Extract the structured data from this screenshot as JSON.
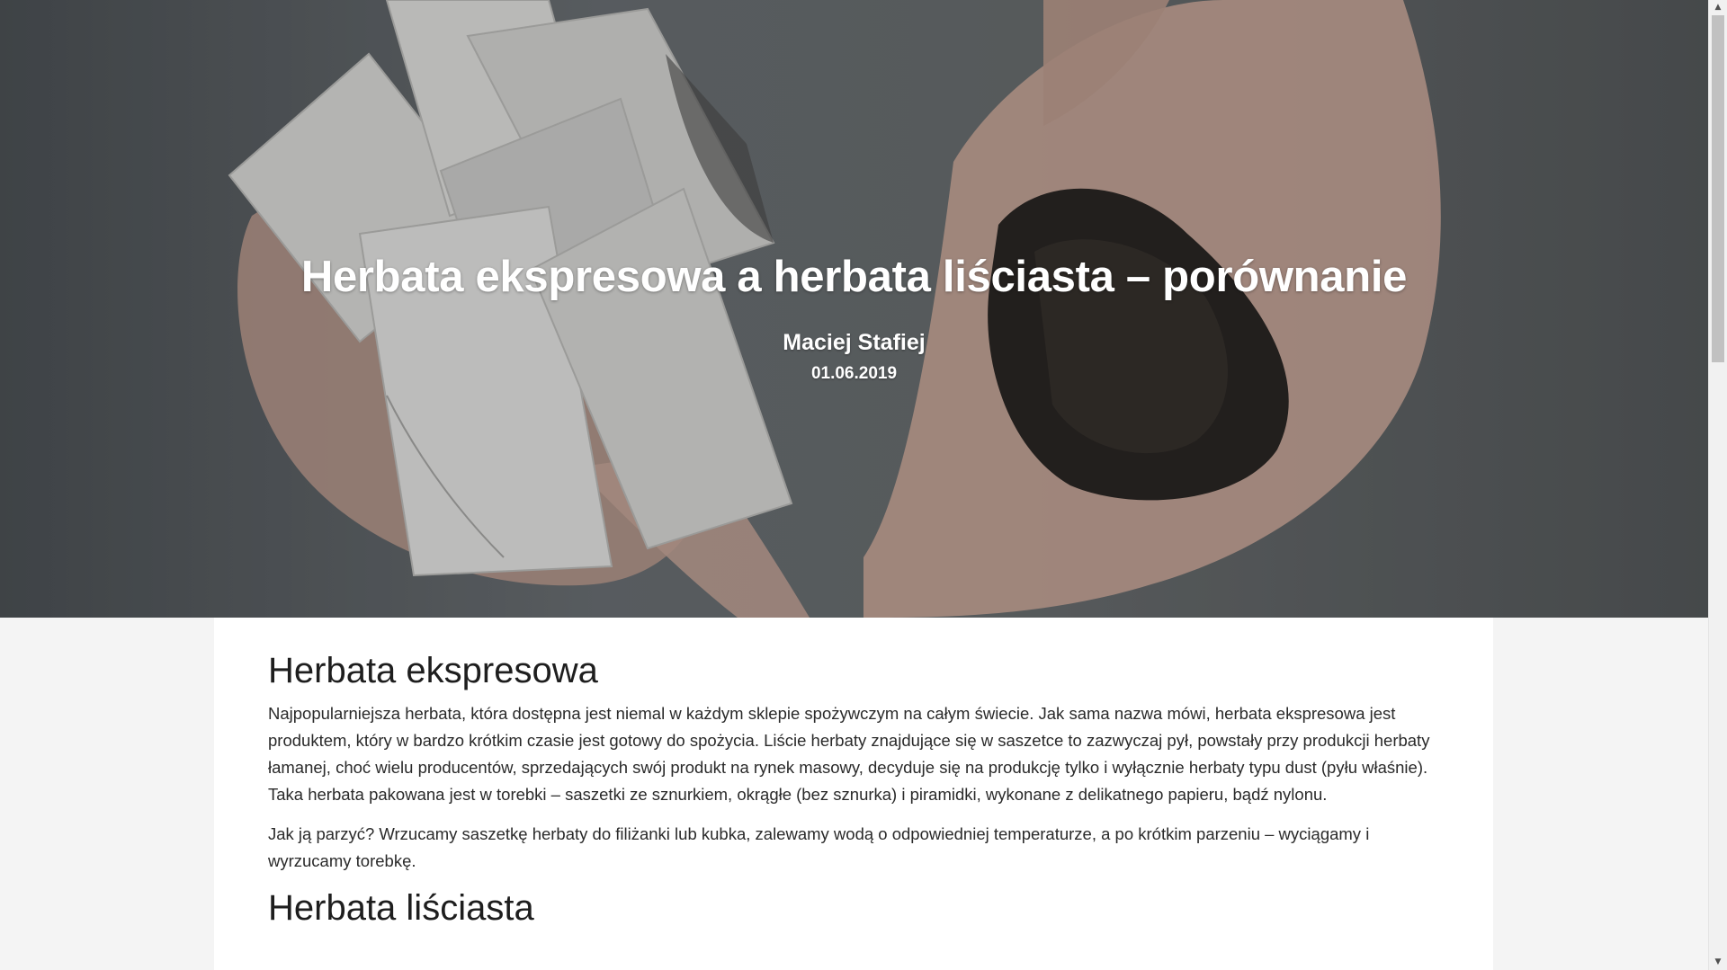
{
  "hero": {
    "title": "Herbata ekspresowa a herbata liściasta – porównanie",
    "author": "Maciej Stafiej",
    "date": "01.06.2019",
    "image_description_icon": "tea-bags-and-loose-leaf-photo"
  },
  "article": {
    "sections": [
      {
        "heading": "Herbata ekspresowa",
        "paragraphs": [
          "Najpopularniejsza herbata, która dostępna jest niemal w każdym sklepie spożywczym na całym świecie. Jak sama nazwa mówi, herbata ekspresowa jest produktem, który w bardzo krótkim czasie jest gotowy do spożycia. Liście herbaty znajdujące się w saszetce to zazwyczaj pył, powstały przy produkcji herbaty łamanej, choć wielu producentów, sprzedających swój produkt na rynek masowy, decyduje się na produkcję tylko i wyłącznie herbaty typu dust (pyłu właśnie). Taka herbata pakowana jest w torebki – saszetki ze sznurkiem, okrągłe (bez sznurka) i piramidki, wykonane z delikatnego papieru, bądź nylonu.",
          "Jak ją parzyć? Wrzucamy saszetkę herbaty do filiżanki lub kubka, zalewamy wodą o odpowiedniej temperaturze, a po krótkim parzeniu – wyciągamy i wyrzucamy torebkę."
        ]
      },
      {
        "heading": "Herbata liściasta"
      }
    ]
  },
  "scrollbar": {
    "up_icon": "scroll-up-arrow-icon",
    "down_icon": "scroll-down-arrow-icon"
  },
  "colors": {
    "page_background": "#f4f4f4",
    "card_background": "#ffffff",
    "hero_text": "#ffffff",
    "body_text": "#2a2a2a"
  }
}
